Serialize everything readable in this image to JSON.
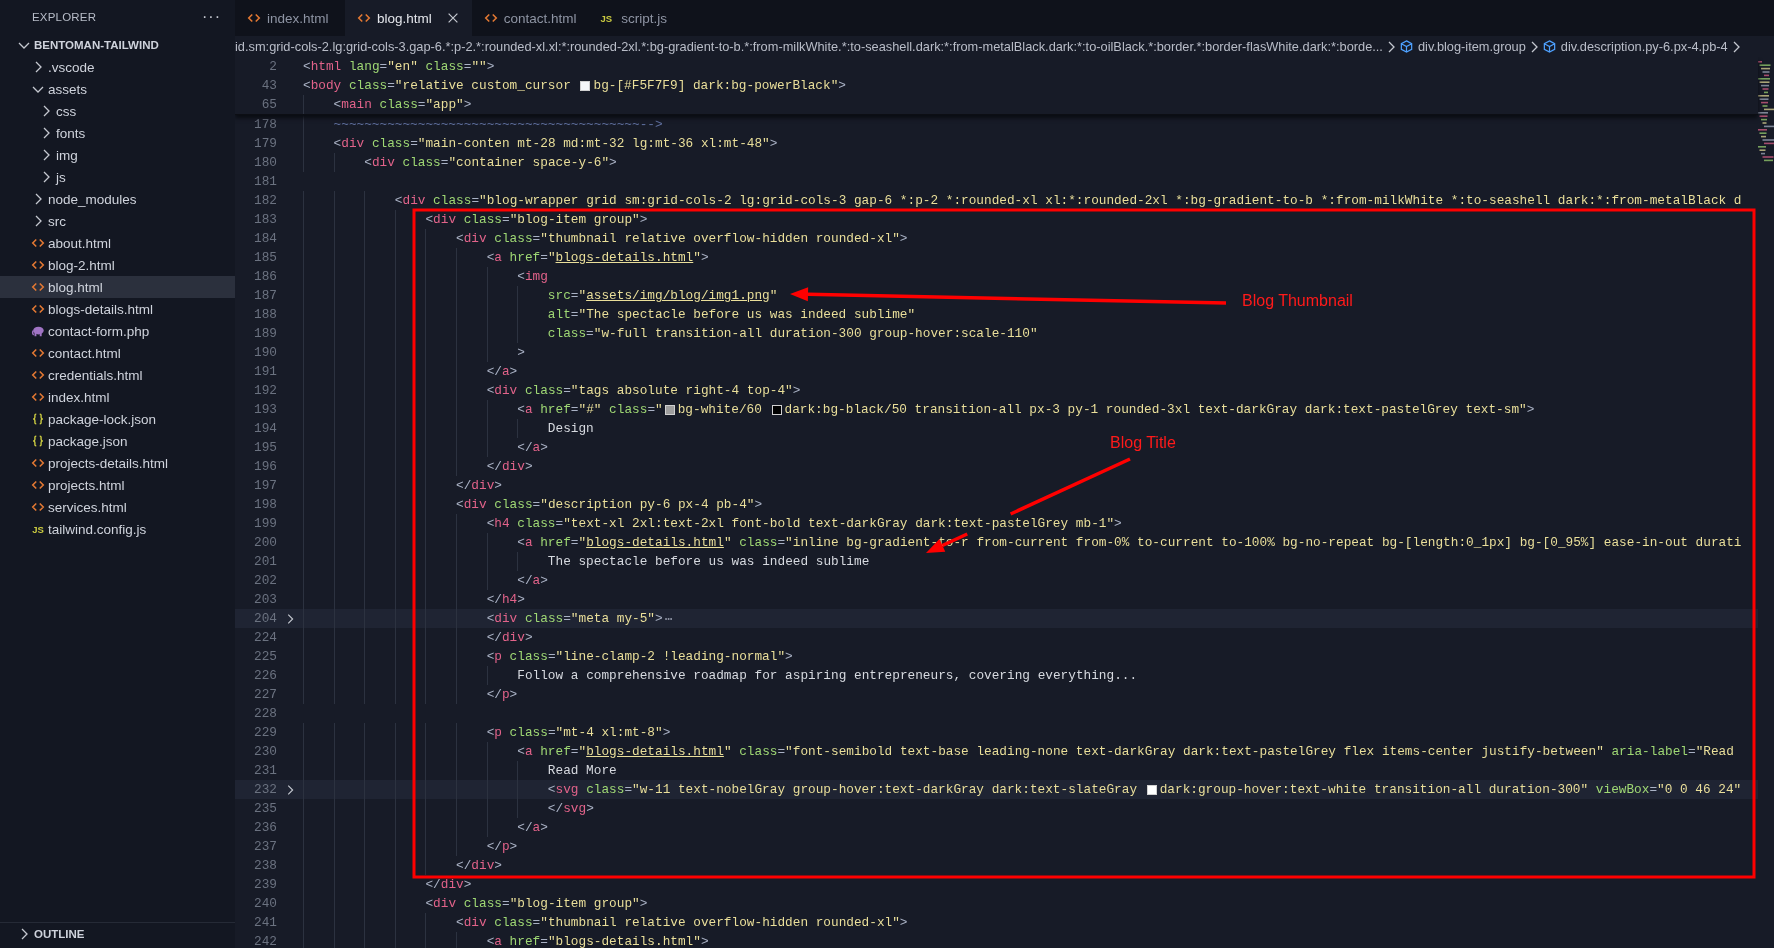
{
  "sidebar": {
    "title": "EXPLORER",
    "menu": "···",
    "root": {
      "label": "BENTOMAN-TAILWIND",
      "expanded": true,
      "children": [
        {
          "label": ".vscode",
          "kind": "folder",
          "expanded": false,
          "selected": false
        },
        {
          "label": "assets",
          "kind": "folder",
          "expanded": true,
          "selected": false,
          "children": [
            {
              "label": "css",
              "kind": "folder",
              "expanded": false,
              "selected": false
            },
            {
              "label": "fonts",
              "kind": "folder",
              "expanded": false,
              "selected": false
            },
            {
              "label": "img",
              "kind": "folder",
              "expanded": false,
              "selected": false
            },
            {
              "label": "js",
              "kind": "folder",
              "expanded": false,
              "selected": false
            }
          ]
        },
        {
          "label": "node_modules",
          "kind": "folder",
          "expanded": false,
          "selected": false
        },
        {
          "label": "src",
          "kind": "folder",
          "expanded": false,
          "selected": false
        },
        {
          "label": "about.html",
          "kind": "html",
          "selected": false
        },
        {
          "label": "blog-2.html",
          "kind": "html",
          "selected": false
        },
        {
          "label": "blog.html",
          "kind": "html",
          "selected": true
        },
        {
          "label": "blogs-details.html",
          "kind": "html",
          "selected": false
        },
        {
          "label": "contact-form.php",
          "kind": "php",
          "selected": false
        },
        {
          "label": "contact.html",
          "kind": "html",
          "selected": false
        },
        {
          "label": "credentials.html",
          "kind": "html",
          "selected": false
        },
        {
          "label": "index.html",
          "kind": "html",
          "selected": false
        },
        {
          "label": "package-lock.json",
          "kind": "json",
          "selected": false
        },
        {
          "label": "package.json",
          "kind": "json",
          "selected": false
        },
        {
          "label": "projects-details.html",
          "kind": "html",
          "selected": false
        },
        {
          "label": "projects.html",
          "kind": "html",
          "selected": false
        },
        {
          "label": "services.html",
          "kind": "html",
          "selected": false
        },
        {
          "label": "tailwind.config.js",
          "kind": "js",
          "badge": "JS",
          "selected": false
        }
      ]
    },
    "outline": {
      "label": "OUTLINE",
      "expanded": false
    }
  },
  "tabs": [
    {
      "label": "index.html",
      "kind": "html",
      "selected": false
    },
    {
      "label": "blog.html",
      "kind": "html",
      "selected": true
    },
    {
      "label": "contact.html",
      "kind": "html",
      "selected": false
    },
    {
      "label": "script.js",
      "kind": "js",
      "badge": "JS",
      "selected": false
    }
  ],
  "breadcrumb": [
    {
      "text": "id.sm:grid-cols-2.lg:grid-cols-3.gap-6.*:p-2.*:rounded-xl.xl:*:rounded-2xl.*:bg-gradient-to-b.*:from-milkWhite.*:to-seashell.dark:*:from-metalBlack.dark:*:to-oilBlack.*:border.*:border-flasWhite.dark:*:borde...",
      "icon": false
    },
    {
      "text": "div.blog-item.group",
      "icon": true
    },
    {
      "text": "div.description.py-6.px-4.pb-4",
      "icon": true
    }
  ],
  "editor": {
    "sticky_lines": [
      {
        "number": "2",
        "folded": false,
        "segments": [
          {
            "kind": "code",
            "text": "<html lang=\"en\" class=\"\">"
          }
        ]
      },
      {
        "number": "43",
        "folded": false,
        "segments": [
          {
            "kind": "code",
            "text": "<body class=\"relative custom_cursor "
          },
          {
            "kind": "swatch",
            "color": "#f5f7f9"
          },
          {
            "kind": "code",
            "text": "bg-[#F5F7F9] dark:bg-powerBlack\">"
          }
        ]
      },
      {
        "number": "65",
        "folded": false,
        "segments": [
          {
            "kind": "code",
            "text": "    <main class=\"app\">"
          }
        ]
      }
    ],
    "lines": [
      {
        "number": "178",
        "folded": false,
        "segments": [
          {
            "kind": "comment",
            "text": "    ~~~~~~~~~~~~~~~~~~~~~~~~~~~~~~~~~~~~~~~~-->"
          }
        ]
      },
      {
        "number": "179",
        "folded": false,
        "segments": [
          {
            "kind": "code",
            "text": "    <div class=\"main-conten mt-28 md:mt-32 lg:mt-36 xl:mt-48\">"
          }
        ]
      },
      {
        "number": "180",
        "folded": false,
        "segments": [
          {
            "kind": "code",
            "text": "        <div class=\"container space-y-6\">"
          }
        ]
      },
      {
        "number": "181",
        "folded": false
      },
      {
        "number": "182",
        "folded": false,
        "segments": [
          {
            "kind": "code",
            "text": "            <div class=\"blog-wrapper grid sm:grid-cols-2 lg:grid-cols-3 gap-6 *:p-2 *:rounded-xl xl:*:rounded-2xl *:bg-gradient-to-b *:from-milkWhite *:to-seashell dark:*:from-metalBlack d"
          }
        ]
      },
      {
        "number": "183",
        "folded": false,
        "segments": [
          {
            "kind": "code",
            "text": "                <div class=\"blog-item group\">"
          }
        ]
      },
      {
        "number": "184",
        "folded": false,
        "segments": [
          {
            "kind": "code",
            "text": "                    <div class=\"thumbnail relative overflow-hidden rounded-xl\">"
          }
        ]
      },
      {
        "number": "185",
        "folded": false,
        "segments": [
          {
            "kind": "code",
            "text": "                        <a href=\""
          },
          {
            "kind": "link",
            "text": "blogs-details.html"
          },
          {
            "kind": "code",
            "text": "\">"
          }
        ]
      },
      {
        "number": "186",
        "folded": false,
        "segments": [
          {
            "kind": "code",
            "text": "                            <img"
          }
        ]
      },
      {
        "number": "187",
        "folded": false,
        "segments": [
          {
            "kind": "code",
            "text": "                                src=\""
          },
          {
            "kind": "link",
            "text": "assets/img/blog/img1.png"
          },
          {
            "kind": "code",
            "text": "\""
          }
        ]
      },
      {
        "number": "188",
        "folded": false,
        "segments": [
          {
            "kind": "code",
            "text": "                                alt=\"The spectacle before us was indeed sublime\""
          }
        ]
      },
      {
        "number": "189",
        "folded": false,
        "segments": [
          {
            "kind": "code",
            "text": "                                class=\"w-full transition-all duration-300 group-hover:scale-110\""
          }
        ]
      },
      {
        "number": "190",
        "folded": false,
        "segments": [
          {
            "kind": "code",
            "text": "                            >"
          }
        ]
      },
      {
        "number": "191",
        "folded": false,
        "segments": [
          {
            "kind": "code",
            "text": "                        </a>"
          }
        ]
      },
      {
        "number": "192",
        "folded": false,
        "segments": [
          {
            "kind": "code",
            "text": "                        <div class=\"tags absolute right-4 top-4\">"
          }
        ]
      },
      {
        "number": "193",
        "folded": false,
        "segments": [
          {
            "kind": "code",
            "text": "                            <a href=\"#\" class=\""
          },
          {
            "kind": "swatch",
            "color": "#9e9e9e"
          },
          {
            "kind": "code",
            "text": "bg-white/60 "
          },
          {
            "kind": "swatch",
            "color": "#000000"
          },
          {
            "kind": "code",
            "text": "dark:bg-black/50 transition-all px-3 py-1 rounded-3xl text-darkGray dark:text-pastelGrey text-sm\">"
          }
        ]
      },
      {
        "number": "194",
        "folded": false,
        "segments": [
          {
            "kind": "code",
            "text": "                                Design"
          }
        ]
      },
      {
        "number": "195",
        "folded": false,
        "segments": [
          {
            "kind": "code",
            "text": "                            </a>"
          }
        ]
      },
      {
        "number": "196",
        "folded": false,
        "segments": [
          {
            "kind": "code",
            "text": "                        </div>"
          }
        ]
      },
      {
        "number": "197",
        "folded": false,
        "segments": [
          {
            "kind": "code",
            "text": "                    </div>"
          }
        ]
      },
      {
        "number": "198",
        "folded": false,
        "segments": [
          {
            "kind": "code",
            "text": "                    <div class=\"description py-6 px-4 pb-4\">"
          }
        ]
      },
      {
        "number": "199",
        "folded": false,
        "segments": [
          {
            "kind": "code",
            "text": "                        <h4 class=\"text-xl 2xl:text-2xl font-bold text-darkGray dark:text-pastelGrey mb-1\">"
          }
        ]
      },
      {
        "number": "200",
        "folded": false,
        "segments": [
          {
            "kind": "code",
            "text": "                            <a href=\""
          },
          {
            "kind": "link",
            "text": "blogs-details.html"
          },
          {
            "kind": "code",
            "text": "\" class=\"inline bg-gradient-to-r from-current from-0% to-current to-100% bg-no-repeat bg-[length:0_1px] bg-[0_95%] ease-in-out durati"
          }
        ]
      },
      {
        "number": "201",
        "folded": false,
        "segments": [
          {
            "kind": "code",
            "text": "                                The spectacle before us was indeed sublime"
          }
        ]
      },
      {
        "number": "202",
        "folded": false,
        "segments": [
          {
            "kind": "code",
            "text": "                            </a>"
          }
        ]
      },
      {
        "number": "203",
        "folded": false,
        "segments": [
          {
            "kind": "code",
            "text": "                        </h4>"
          }
        ]
      },
      {
        "number": "204",
        "folded": true,
        "segments": [
          {
            "kind": "code",
            "text": "                        <div class=\"meta my-5\">"
          },
          {
            "kind": "fold",
            "text": "⋯"
          }
        ]
      },
      {
        "number": "224",
        "folded": false,
        "segments": [
          {
            "kind": "code",
            "text": "                        </div>"
          }
        ]
      },
      {
        "number": "225",
        "folded": false,
        "segments": [
          {
            "kind": "code",
            "text": "                        <p class=\"line-clamp-2 !leading-normal\">"
          }
        ]
      },
      {
        "number": "226",
        "folded": false,
        "segments": [
          {
            "kind": "code",
            "text": "                            Follow a comprehensive roadmap for aspiring entrepreneurs, covering everything..."
          }
        ]
      },
      {
        "number": "227",
        "folded": false,
        "segments": [
          {
            "kind": "code",
            "text": "                        </p>"
          }
        ]
      },
      {
        "number": "228",
        "folded": false
      },
      {
        "number": "229",
        "folded": false,
        "segments": [
          {
            "kind": "code",
            "text": "                        <p class=\"mt-4 xl:mt-8\">"
          }
        ]
      },
      {
        "number": "230",
        "folded": false,
        "segments": [
          {
            "kind": "code",
            "text": "                            <a href=\""
          },
          {
            "kind": "link",
            "text": "blogs-details.html"
          },
          {
            "kind": "code",
            "text": "\" class=\"font-semibold text-base leading-none text-darkGray dark:text-pastelGrey flex items-center justify-between\" aria-label=\"Read"
          }
        ]
      },
      {
        "number": "231",
        "folded": false,
        "segments": [
          {
            "kind": "code",
            "text": "                                Read More"
          }
        ]
      },
      {
        "number": "232",
        "folded": true,
        "segments": [
          {
            "kind": "code",
            "text": "                                <svg class=\"w-11 text-nobelGray group-hover:text-darkGray dark:text-slateGray "
          },
          {
            "kind": "swatch",
            "color": "#ffffff"
          },
          {
            "kind": "code",
            "text": "dark:group-hover:text-white transition-all duration-300\" viewBox=\"0 0 46 24\""
          }
        ]
      },
      {
        "number": "235",
        "folded": false,
        "segments": [
          {
            "kind": "code",
            "text": "                                </svg>"
          }
        ]
      },
      {
        "number": "236",
        "folded": false,
        "segments": [
          {
            "kind": "code",
            "text": "                            </a>"
          }
        ]
      },
      {
        "number": "237",
        "folded": false,
        "segments": [
          {
            "kind": "code",
            "text": "                        </p>"
          }
        ]
      },
      {
        "number": "238",
        "folded": false,
        "segments": [
          {
            "kind": "code",
            "text": "                    </div>"
          }
        ]
      },
      {
        "number": "239",
        "folded": false,
        "segments": [
          {
            "kind": "code",
            "text": "                </div>"
          }
        ]
      },
      {
        "number": "240",
        "folded": false,
        "segments": [
          {
            "kind": "code",
            "text": "                <div class=\"blog-item group\">"
          }
        ]
      },
      {
        "number": "241",
        "folded": false,
        "segments": [
          {
            "kind": "code",
            "text": "                    <div class=\"thumbnail relative overflow-hidden rounded-xl\">"
          }
        ]
      },
      {
        "number": "242",
        "folded": false,
        "segments": [
          {
            "kind": "code",
            "text": "                        <a href=\"blogs-details.html\">"
          }
        ]
      }
    ]
  },
  "annotations": [
    {
      "text": "Blog Thumbnail"
    },
    {
      "text": "Blog Title"
    }
  ]
}
